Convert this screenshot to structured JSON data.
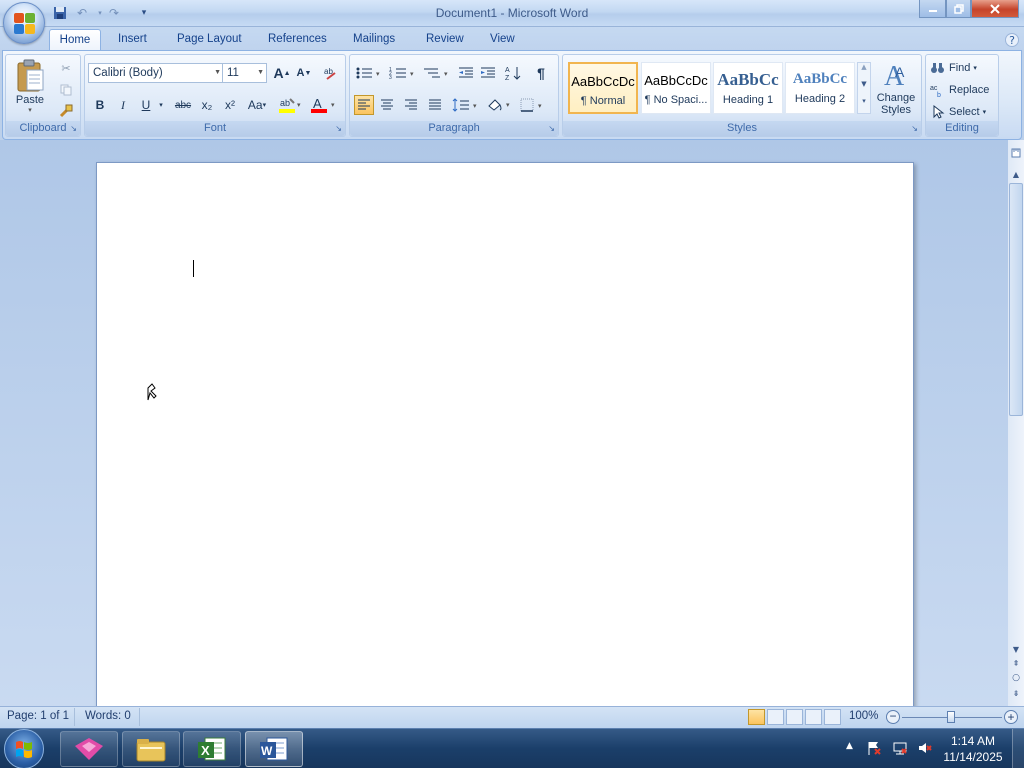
{
  "window": {
    "title": "Document1 - Microsoft Word"
  },
  "qat": {
    "save": "save-icon",
    "undo": "undo-icon",
    "redo": "redo-icon",
    "customize": "customize-qat-icon"
  },
  "tabs": [
    {
      "label": "Home"
    },
    {
      "label": "Insert"
    },
    {
      "label": "Page Layout"
    },
    {
      "label": "References"
    },
    {
      "label": "Mailings"
    },
    {
      "label": "Review"
    },
    {
      "label": "View"
    }
  ],
  "ribbon": {
    "clipboard": {
      "label": "Clipboard",
      "paste": "Paste"
    },
    "font": {
      "label": "Font",
      "font_name": "Calibri (Body)",
      "font_size": "11",
      "bold": "B",
      "italic": "I",
      "underline": "U",
      "strike": "abc",
      "subscript": "x₂",
      "superscript": "x²",
      "change_case": "Aa",
      "grow": "A",
      "shrink": "A"
    },
    "paragraph": {
      "label": "Paragraph",
      "show_marks": "¶"
    },
    "styles": {
      "label": "Styles",
      "items": [
        {
          "preview": "AaBbCcDc",
          "name": "¶ Normal"
        },
        {
          "preview": "AaBbCcDc",
          "name": "¶ No Spaci..."
        },
        {
          "preview": "AaBbCc",
          "name": "Heading 1"
        },
        {
          "preview": "AaBbCc",
          "name": "Heading 2"
        }
      ],
      "change_styles": "Change Styles"
    },
    "editing": {
      "label": "Editing",
      "find": "Find",
      "replace": "Replace",
      "select": "Select"
    }
  },
  "status": {
    "page": "Page: 1 of 1",
    "words": "Words: 0",
    "zoom": "100%"
  },
  "taskbar": {
    "time": "1:14 AM",
    "date": "11/14/2025"
  },
  "colors": {
    "accent": "#15428b",
    "highlight": "#ffff00",
    "font_color": "#ff0000",
    "selected_style": "#f1b54f"
  }
}
